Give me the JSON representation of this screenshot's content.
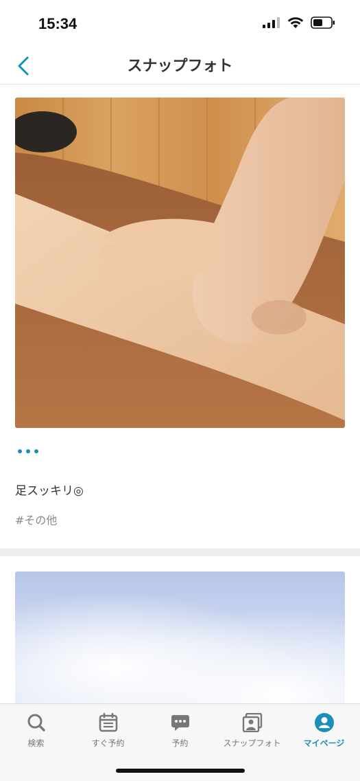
{
  "status_bar": {
    "time": "15:34"
  },
  "nav": {
    "title": "スナップフォト"
  },
  "post": {
    "caption": "足スッキリ◎",
    "hashtag": "#その他"
  },
  "tabs": [
    {
      "label": "検索",
      "icon": "search-icon",
      "active": false
    },
    {
      "label": "すぐ予約",
      "icon": "calendar-icon",
      "active": false
    },
    {
      "label": "予約",
      "icon": "chat-icon",
      "active": false
    },
    {
      "label": "スナップフォト",
      "icon": "photo-icon",
      "active": false
    },
    {
      "label": "マイページ",
      "icon": "profile-icon",
      "active": true
    }
  ],
  "colors": {
    "accent": "#1a8fb8",
    "inactive": "#777777",
    "divider": "#efefef"
  }
}
